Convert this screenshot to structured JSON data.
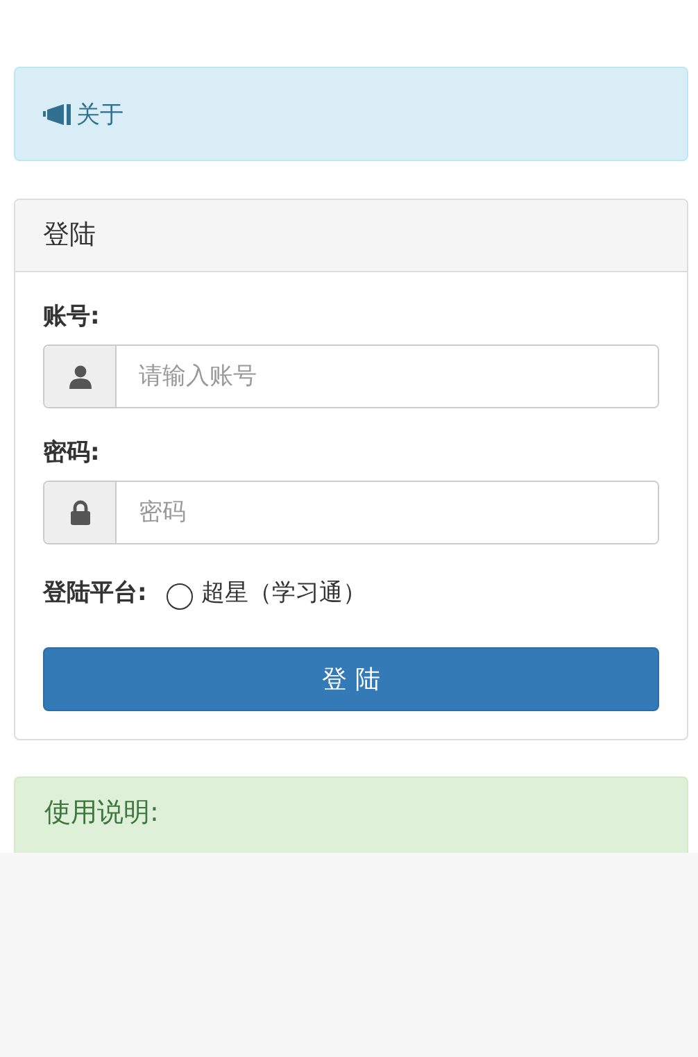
{
  "about_alert": {
    "text": "关于"
  },
  "login_panel": {
    "title": "登陆",
    "fields": [
      {
        "label": "账号:",
        "kind": "account",
        "placeholder": "请输入账号"
      },
      {
        "label": "密码:",
        "kind": "password",
        "placeholder": "密码"
      }
    ],
    "platform": {
      "label": "登陆平台:",
      "options": [
        {
          "label": "超星（学习通）",
          "selected": false
        }
      ]
    },
    "submit": "登 陆"
  },
  "instructions_alert": {
    "text": "使用说明:"
  }
}
